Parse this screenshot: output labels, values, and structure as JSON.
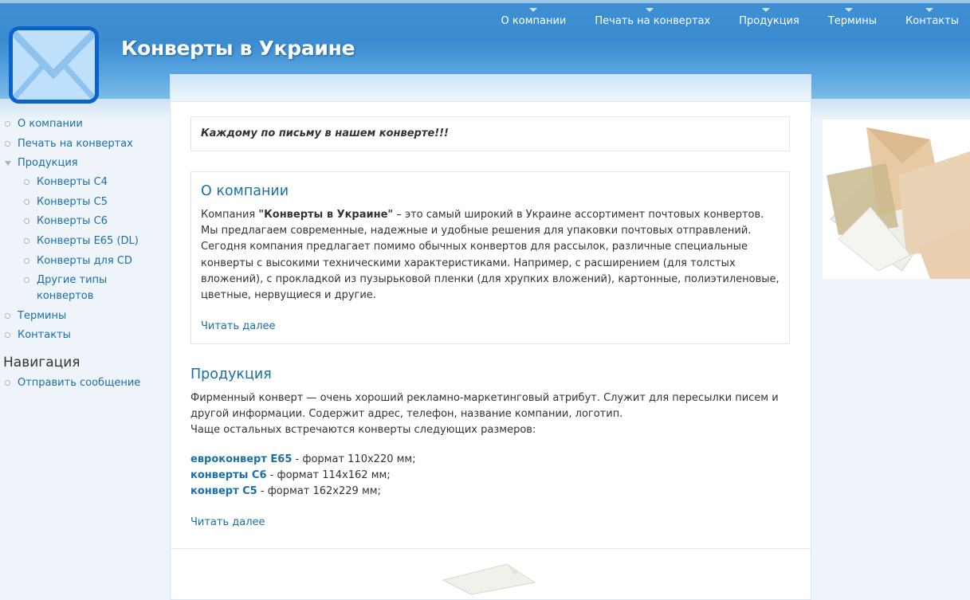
{
  "site": {
    "name": "Конверты в Украине"
  },
  "primary_links": [
    "О компании",
    "Печать на конвертах",
    "Продукция",
    "Термины",
    "Контакты"
  ],
  "sidebar": {
    "menu": [
      {
        "label": "О компании"
      },
      {
        "label": "Печать на конвертах"
      },
      {
        "label": "Продукция",
        "children": [
          "Конверты С4",
          "Конверты С5",
          "Конверты С6",
          "Конверты Е65 (DL)",
          "Конверты для CD",
          "Другие типы конвертов"
        ]
      },
      {
        "label": "Термины"
      },
      {
        "label": "Контакты"
      }
    ],
    "nav_title": "Навигация",
    "nav_items": [
      "Отправить сообщение"
    ]
  },
  "slogan": "Каждому по письму в нашем конверте!!!",
  "about": {
    "title": "О компании",
    "p1_prefix": "Компания ",
    "p1_bold": "\"Конверты в Украине\"",
    "p1_suffix": " – это самый широкий в Украине ассортимент почтовых конвертов. Мы предлагаем современные, надежные и удобные решения для упаковки почтовых отправлений.",
    "p2": "Сегодня компания предлагает помимо обычных конвертов для рассылок, различные специальные конверты с высокими техническими характеристиками. Например, с расширением (для толстых вложений), с прокладкой из пузырьковой пленки (для хрупких вложений), картонные, полиэтиленовые, цветные, нервущиеся и другие.",
    "read_more": "Читать далее"
  },
  "products": {
    "title": "Продукция",
    "p1": "Фирменный конверт — очень хороший рекламно-маркетинговый атрибут. Служит для пересылки писем и другой информации. Содержит адрес, телефон, название компании, логотип.",
    "p2": "Чаще остальных встречаются конверты следующих размеров:",
    "formats": [
      {
        "name": "евроконверт Е65",
        "desc": " - формат 110х220 мм;"
      },
      {
        "name": "конверты С6",
        "desc": " - формат 114х162 мм;"
      },
      {
        "name": "конверт С5",
        "desc": " - формат 162х229 мм;"
      }
    ],
    "read_more": "Читать далее"
  }
}
